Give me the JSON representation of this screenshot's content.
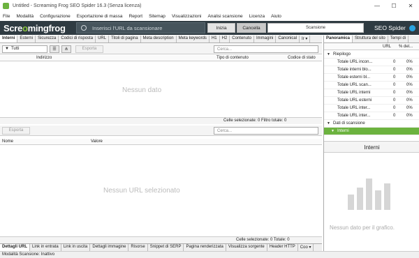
{
  "window": {
    "title": "Untitled - Screaming Frog SEO Spider 16.3 (Senza licenza)",
    "controls": [
      "—",
      "☐",
      "✕"
    ]
  },
  "menu": [
    "File",
    "Modalità",
    "Configurazione",
    "Esportazione di massa",
    "Report",
    "Sitemap",
    "Visualizzazioni",
    "Analisi scansione",
    "Licenza",
    "Aiuto"
  ],
  "toolbar": {
    "logo_pre": "Scre",
    "logo_o": "o",
    "logo_mid": "ming",
    "logo_post": "frog",
    "url_placeholder": "Inserisci l'URL da scansionare",
    "start_label": "Inizia",
    "cancel_label": "Cancella",
    "scan_label": "Scansione",
    "product": "SEO Spider"
  },
  "main_tabs": [
    "Interni",
    "Esterni",
    "Sicurezza",
    "Codici di risposta",
    "URL",
    "Titoli di pagina",
    "Meta description",
    "Meta keywords",
    "H1",
    "H2",
    "Contenuto",
    "Immagini",
    "Canonical",
    "Ir ▾"
  ],
  "top_grid": {
    "filter_value": "Tutti",
    "export_label": "Esporta",
    "search_placeholder": "Cerca...",
    "col_address": "Indirizzo",
    "col_content_type": "Tipo di contenuto",
    "col_status": "Codice di stato",
    "empty": "Nessun dato",
    "status": "Celle selezionate:  0  Filtro totale:  0"
  },
  "bottom_grid": {
    "export_label": "Esporta",
    "search_placeholder": "Cerca...",
    "col_name": "Nome",
    "col_value": "Valore",
    "empty": "Nessun URL selezionato",
    "status": "Celle selezionate:  0  Totale:  0"
  },
  "bottom_tabs": [
    "Dettagli URL",
    "Link in entrata",
    "Link in uscita",
    "Dettagli immagine",
    "Risorse",
    "Snippet di SERP",
    "Pagina renderizzata",
    "Visualizza sorgente",
    "Header HTTP",
    "Coo ▾"
  ],
  "status_bar": "Modalità Scansione: Inattivo",
  "right_panel": {
    "tabs": [
      "Panoramica",
      "Struttura del sito",
      "Tempi di"
    ],
    "col_url": "URL",
    "col_pct": "% del...",
    "section_summary": "Riepilogo",
    "rows": [
      {
        "label": "Totale URL incon...",
        "url": "0",
        "pct": "0%"
      },
      {
        "label": "Totale interni blo...",
        "url": "0",
        "pct": "0%"
      },
      {
        "label": "Totale esterni bl...",
        "url": "0",
        "pct": "0%"
      },
      {
        "label": "Totale URL scan...",
        "url": "0",
        "pct": "0%"
      },
      {
        "label": "Totale URL interni",
        "url": "0",
        "pct": "0%"
      },
      {
        "label": "Totale URL esterni",
        "url": "0",
        "pct": "0%"
      },
      {
        "label": "Totale URL inter...",
        "url": "0",
        "pct": "0%"
      },
      {
        "label": "Totale URL inter...",
        "url": "0",
        "pct": "0%"
      }
    ],
    "section_scan": "Dati di scansione",
    "selected": "Interni",
    "panel_title": "Interni",
    "chart_empty": "Nessun dato per il grafico."
  }
}
